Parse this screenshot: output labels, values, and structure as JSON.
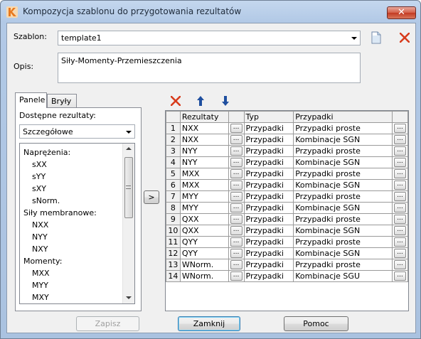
{
  "window": {
    "title": "Kompozycja szablonu do przygotowania rezultatów",
    "close_label": "✕"
  },
  "szablon": {
    "label": "Szablon:",
    "value": "template1"
  },
  "opis": {
    "label": "Opis:",
    "value": "Siły-Momenty-Przemieszczenia"
  },
  "tabs": [
    {
      "label": "Panele"
    },
    {
      "label": "Bryły"
    }
  ],
  "left": {
    "available_label": "Dostępne rezultaty:",
    "detail_combo": "Szczegółowe",
    "items": [
      {
        "text": "Naprężenia:",
        "indent": 0
      },
      {
        "text": "sXX",
        "indent": 1
      },
      {
        "text": "sYY",
        "indent": 1
      },
      {
        "text": "sXY",
        "indent": 1
      },
      {
        "text": "sNorm.",
        "indent": 1
      },
      {
        "text": "Siły membranowe:",
        "indent": 0
      },
      {
        "text": "NXX",
        "indent": 1
      },
      {
        "text": "NYY",
        "indent": 1
      },
      {
        "text": "NXY",
        "indent": 1
      },
      {
        "text": "Momenty:",
        "indent": 0
      },
      {
        "text": "MXX",
        "indent": 1
      },
      {
        "text": "MYY",
        "indent": 1
      },
      {
        "text": "MXY",
        "indent": 1
      }
    ]
  },
  "move_button": ">",
  "grid": {
    "headers": [
      "Rezultaty",
      "Typ",
      "Przypadki"
    ],
    "ellipsis": "...",
    "rows": [
      {
        "n": "1",
        "rez": "NXX",
        "typ": "Przypadki",
        "prz": "Przypadki proste"
      },
      {
        "n": "2",
        "rez": "NXX",
        "typ": "Przypadki",
        "prz": "Kombinacje SGN"
      },
      {
        "n": "3",
        "rez": "NYY",
        "typ": "Przypadki",
        "prz": "Przypadki proste"
      },
      {
        "n": "4",
        "rez": "NYY",
        "typ": "Przypadki",
        "prz": "Kombinacje SGN"
      },
      {
        "n": "5",
        "rez": "MXX",
        "typ": "Przypadki",
        "prz": "Przypadki proste"
      },
      {
        "n": "6",
        "rez": "MXX",
        "typ": "Przypadki",
        "prz": "Kombinacje SGN"
      },
      {
        "n": "7",
        "rez": "MYY",
        "typ": "Przypadki",
        "prz": "Przypadki proste"
      },
      {
        "n": "8",
        "rez": "MYY",
        "typ": "Przypadki",
        "prz": "Kombinacje SGN"
      },
      {
        "n": "9",
        "rez": "QXX",
        "typ": "Przypadki",
        "prz": "Przypadki proste"
      },
      {
        "n": "10",
        "rez": "QXX",
        "typ": "Przypadki",
        "prz": "Kombinacje SGN"
      },
      {
        "n": "11",
        "rez": "QYY",
        "typ": "Przypadki",
        "prz": "Przypadki proste"
      },
      {
        "n": "12",
        "rez": "QYY",
        "typ": "Przypadki",
        "prz": "Kombinacje SGN"
      },
      {
        "n": "13",
        "rez": "WNorm.",
        "typ": "Przypadki",
        "prz": "Przypadki proste"
      },
      {
        "n": "14",
        "rez": "WNorm.",
        "typ": "Przypadki",
        "prz": "Kombinacje SGU"
      }
    ]
  },
  "buttons": {
    "zapisz": "Zapisz",
    "zamknij": "Zamknij",
    "pomoc": "Pomoc"
  },
  "colors": {
    "delete_red": "#d83b1c",
    "arrow_blue": "#1f4f9f",
    "accent": "#3c7fb1"
  }
}
